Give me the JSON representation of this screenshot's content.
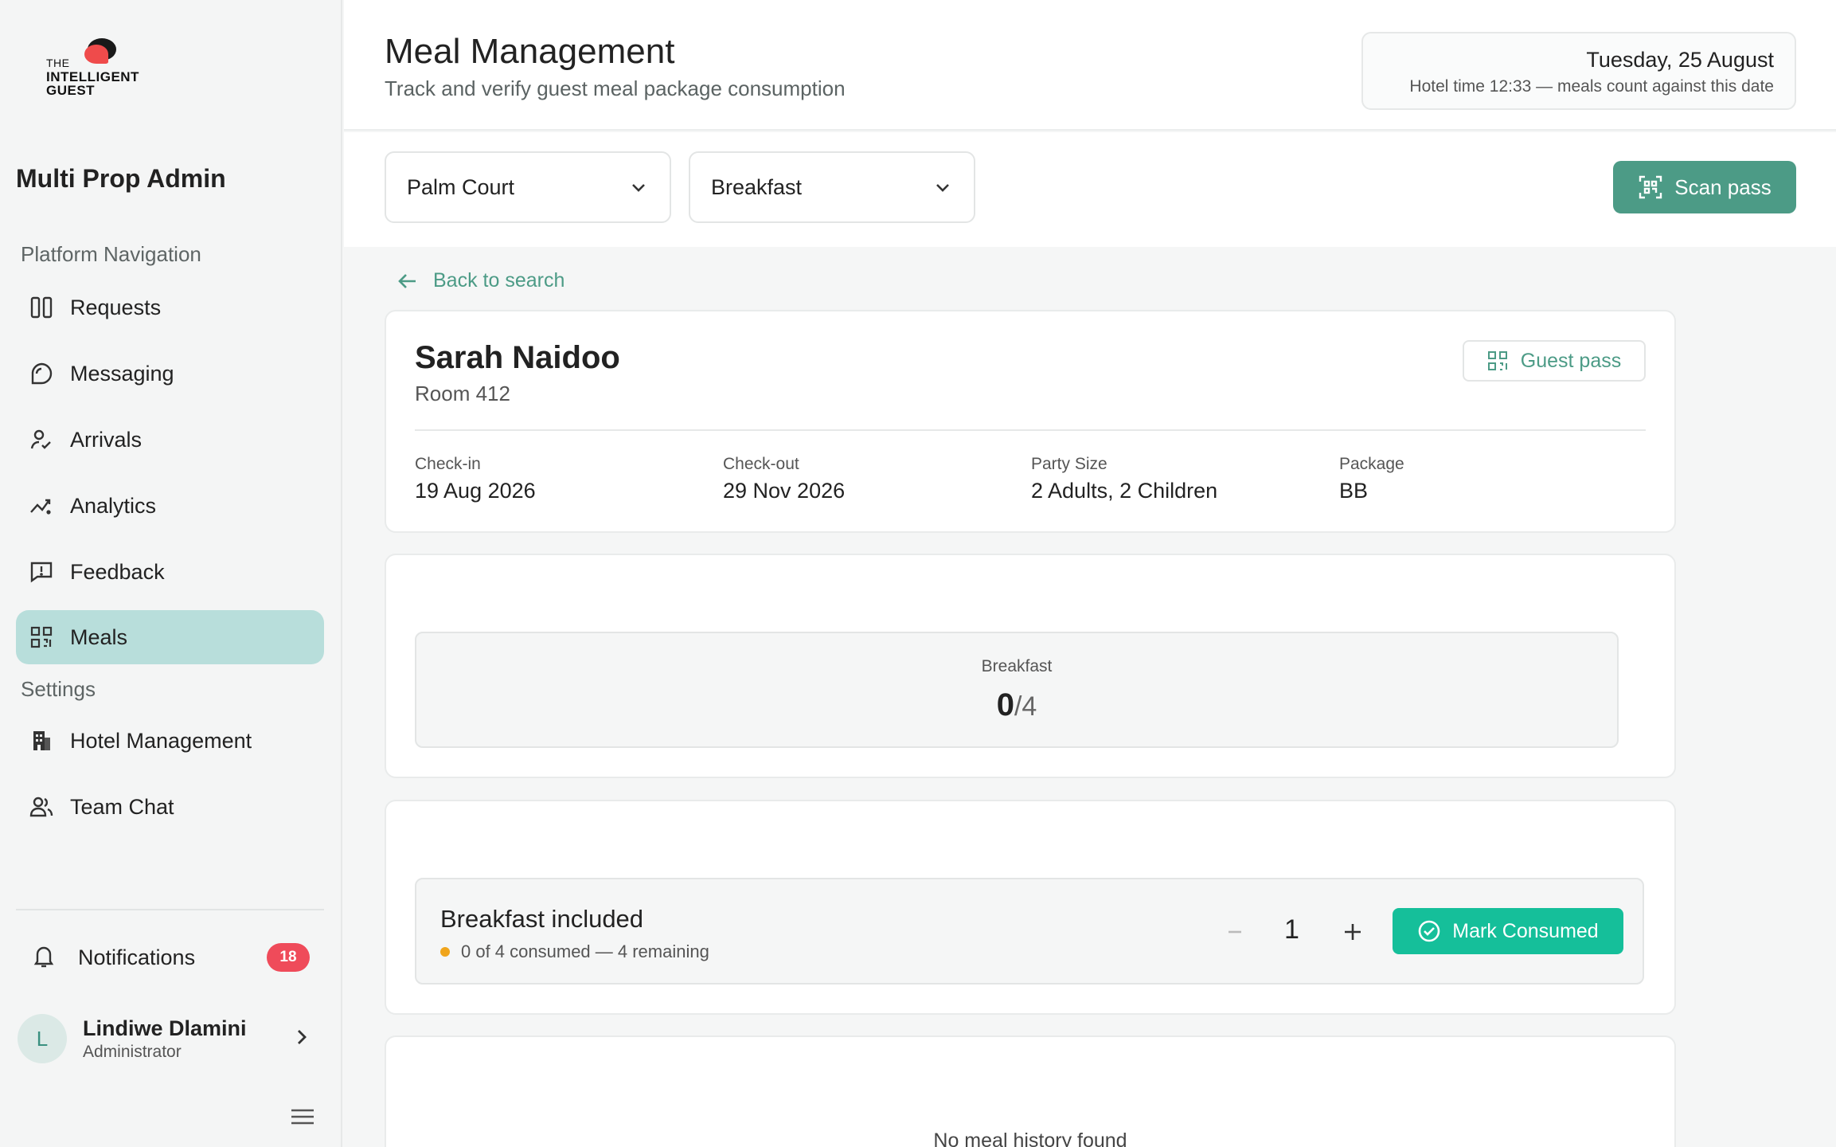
{
  "sidebar": {
    "logo": {
      "line1": "THE",
      "line2": "INTELLIGENT",
      "line3": "GUEST"
    },
    "org_title": "Multi Prop Admin",
    "section_platform": "Platform Navigation",
    "section_settings": "Settings",
    "items": [
      {
        "label": "Requests",
        "icon": "columns-icon"
      },
      {
        "label": "Messaging",
        "icon": "chat-bubble-icon"
      },
      {
        "label": "Arrivals",
        "icon": "user-check-icon"
      },
      {
        "label": "Analytics",
        "icon": "trend-line-icon"
      },
      {
        "label": "Feedback",
        "icon": "feedback-icon"
      },
      {
        "label": "Meals",
        "icon": "qr-icon",
        "active": true
      }
    ],
    "settings_items": [
      {
        "label": "Hotel Management",
        "icon": "building-icon"
      },
      {
        "label": "Team Chat",
        "icon": "users-icon"
      }
    ],
    "notifications": {
      "label": "Notifications",
      "count": "18"
    },
    "user": {
      "initial": "L",
      "name": "Lindiwe Dlamini",
      "role": "Administrator"
    }
  },
  "header": {
    "title": "Meal Management",
    "subtitle": "Track and verify guest meal package consumption",
    "date": "Tuesday, 25 August",
    "hotel_time": "Hotel time 12:33 — meals count against this date"
  },
  "filters": {
    "outlet": "Palm Court",
    "meal": "Breakfast",
    "scan_label": "Scan pass"
  },
  "back_label": "Back to search",
  "guest": {
    "name": "Sarah Naidoo",
    "room": "Room 412",
    "pass_label": "Guest pass",
    "checkin_label": "Check-in",
    "checkin": "19 Aug 2026",
    "checkout_label": "Check-out",
    "checkout": "29 Nov 2026",
    "party_label": "Party Size",
    "party": "2 Adults, 2 Children",
    "package_label": "Package",
    "package": "BB"
  },
  "summary": {
    "label": "Breakfast",
    "consumed": "0",
    "total": "/4"
  },
  "meal_row": {
    "title": "Breakfast included",
    "status": "0 of 4 consumed — 4 remaining",
    "quantity": "1",
    "mark_label": "Mark Consumed"
  },
  "history": {
    "empty": "No meal history found"
  },
  "colors": {
    "accent": "#4c9b86",
    "active_nav": "#b8dedb",
    "success": "#15bf9a",
    "badge": "#ef4b5a",
    "warning_dot": "#f0a51c"
  }
}
